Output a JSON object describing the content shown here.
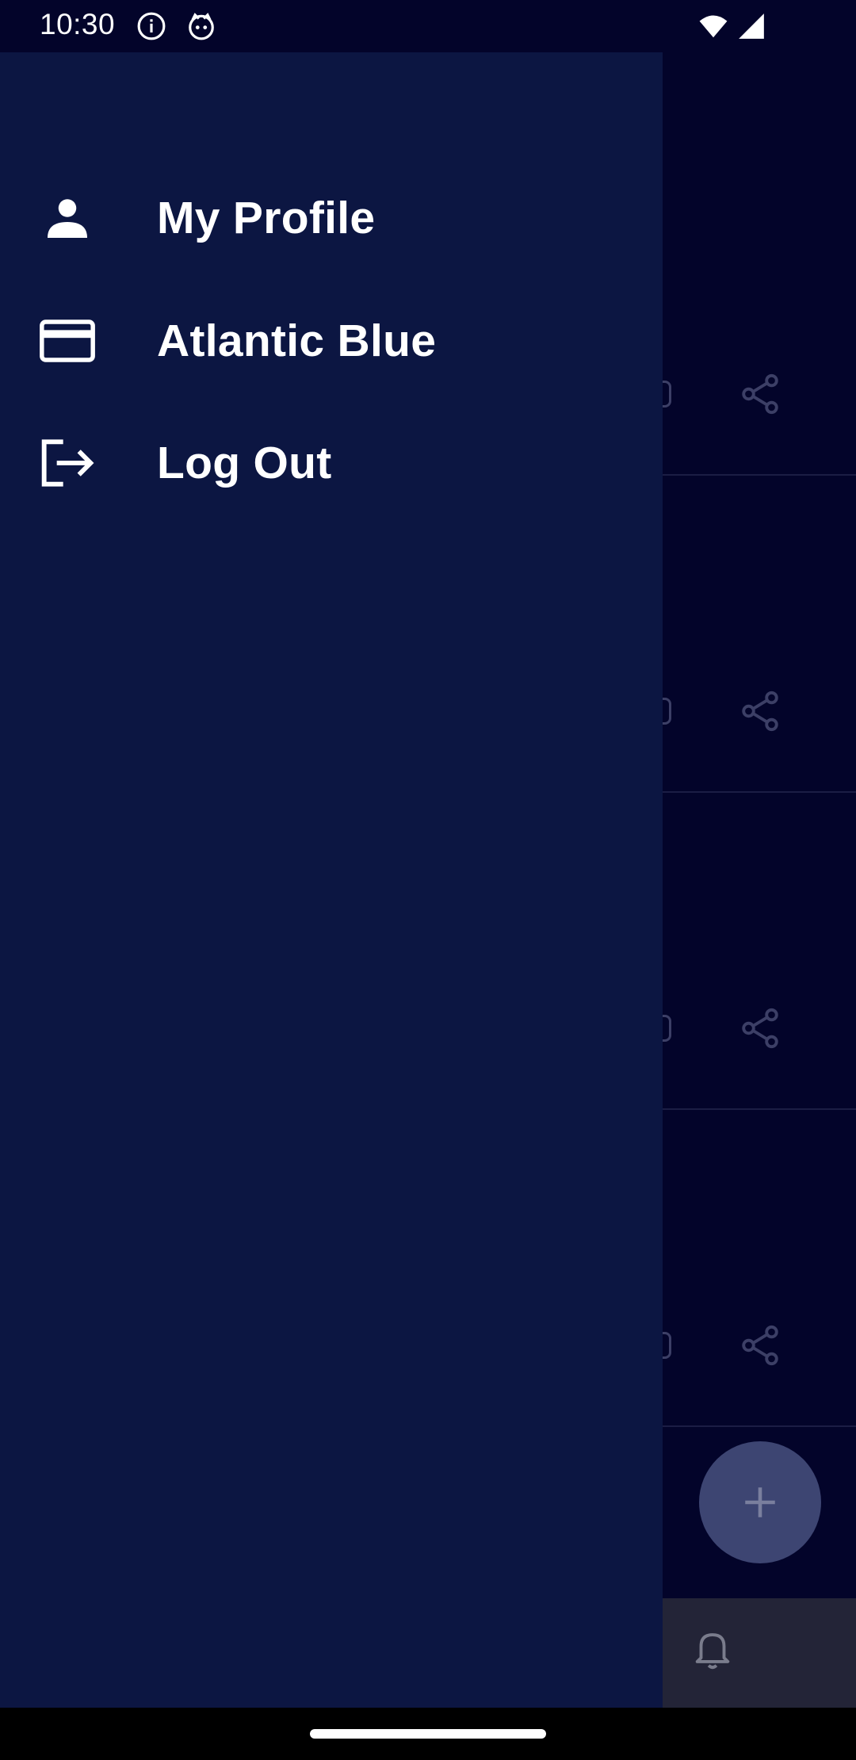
{
  "status_bar": {
    "time": "10:30",
    "left_icons": [
      "info-icon",
      "cat-icon"
    ],
    "right_icons": [
      "wifi-icon",
      "signal-icon"
    ]
  },
  "drawer": {
    "items": [
      {
        "label": "My Profile",
        "icon": "person-icon"
      },
      {
        "label": "Atlantic Blue",
        "icon": "credit-card-icon"
      },
      {
        "label": "Log Out",
        "icon": "logout-icon"
      }
    ]
  },
  "background": {
    "row_count": 4,
    "row_icons": [
      "share-icon"
    ],
    "fab_icon": "plus-icon",
    "bottom_nav_icon": "bell-icon"
  },
  "colors": {
    "drawer_bg": "#0c1642",
    "screen_bg": "#03042a",
    "fab": "#3d4572",
    "bottom_nav": "#232437",
    "text": "#ffffff"
  }
}
